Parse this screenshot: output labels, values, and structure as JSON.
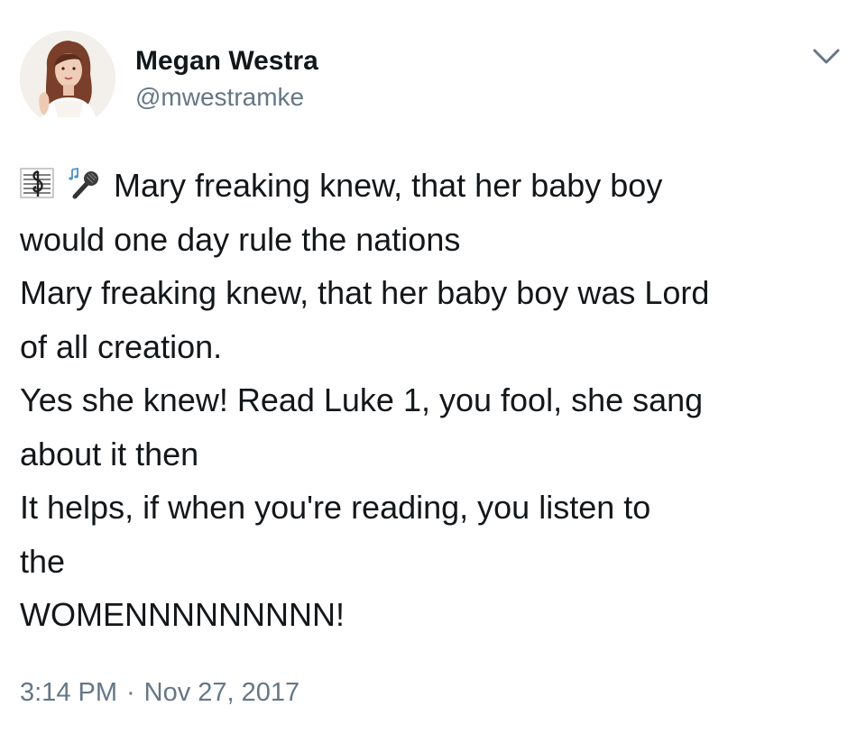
{
  "author": {
    "display_name": "Megan Westra",
    "handle": "@mwestramke",
    "avatar_icon": "profile-photo"
  },
  "tweet": {
    "lead_icons": [
      "sheet-music-emoji",
      "microphone-emoji"
    ],
    "lines": [
      "Mary freaking knew, that her baby boy",
      "would one day rule the nations",
      "Mary freaking knew, that her baby boy was Lord",
      "of all creation.",
      "Yes she knew! Read Luke 1, you fool, she sang",
      "about it then",
      "It helps, if when you're reading, you listen to",
      "the",
      "WOMENNNNNNNNN!"
    ]
  },
  "timestamp": {
    "time": "3:14 PM",
    "separator": "·",
    "date": "Nov 27, 2017"
  },
  "menu": {
    "icon": "chevron-down-icon"
  },
  "colors": {
    "text": "#14171a",
    "secondary": "#657786",
    "background": "#ffffff"
  }
}
